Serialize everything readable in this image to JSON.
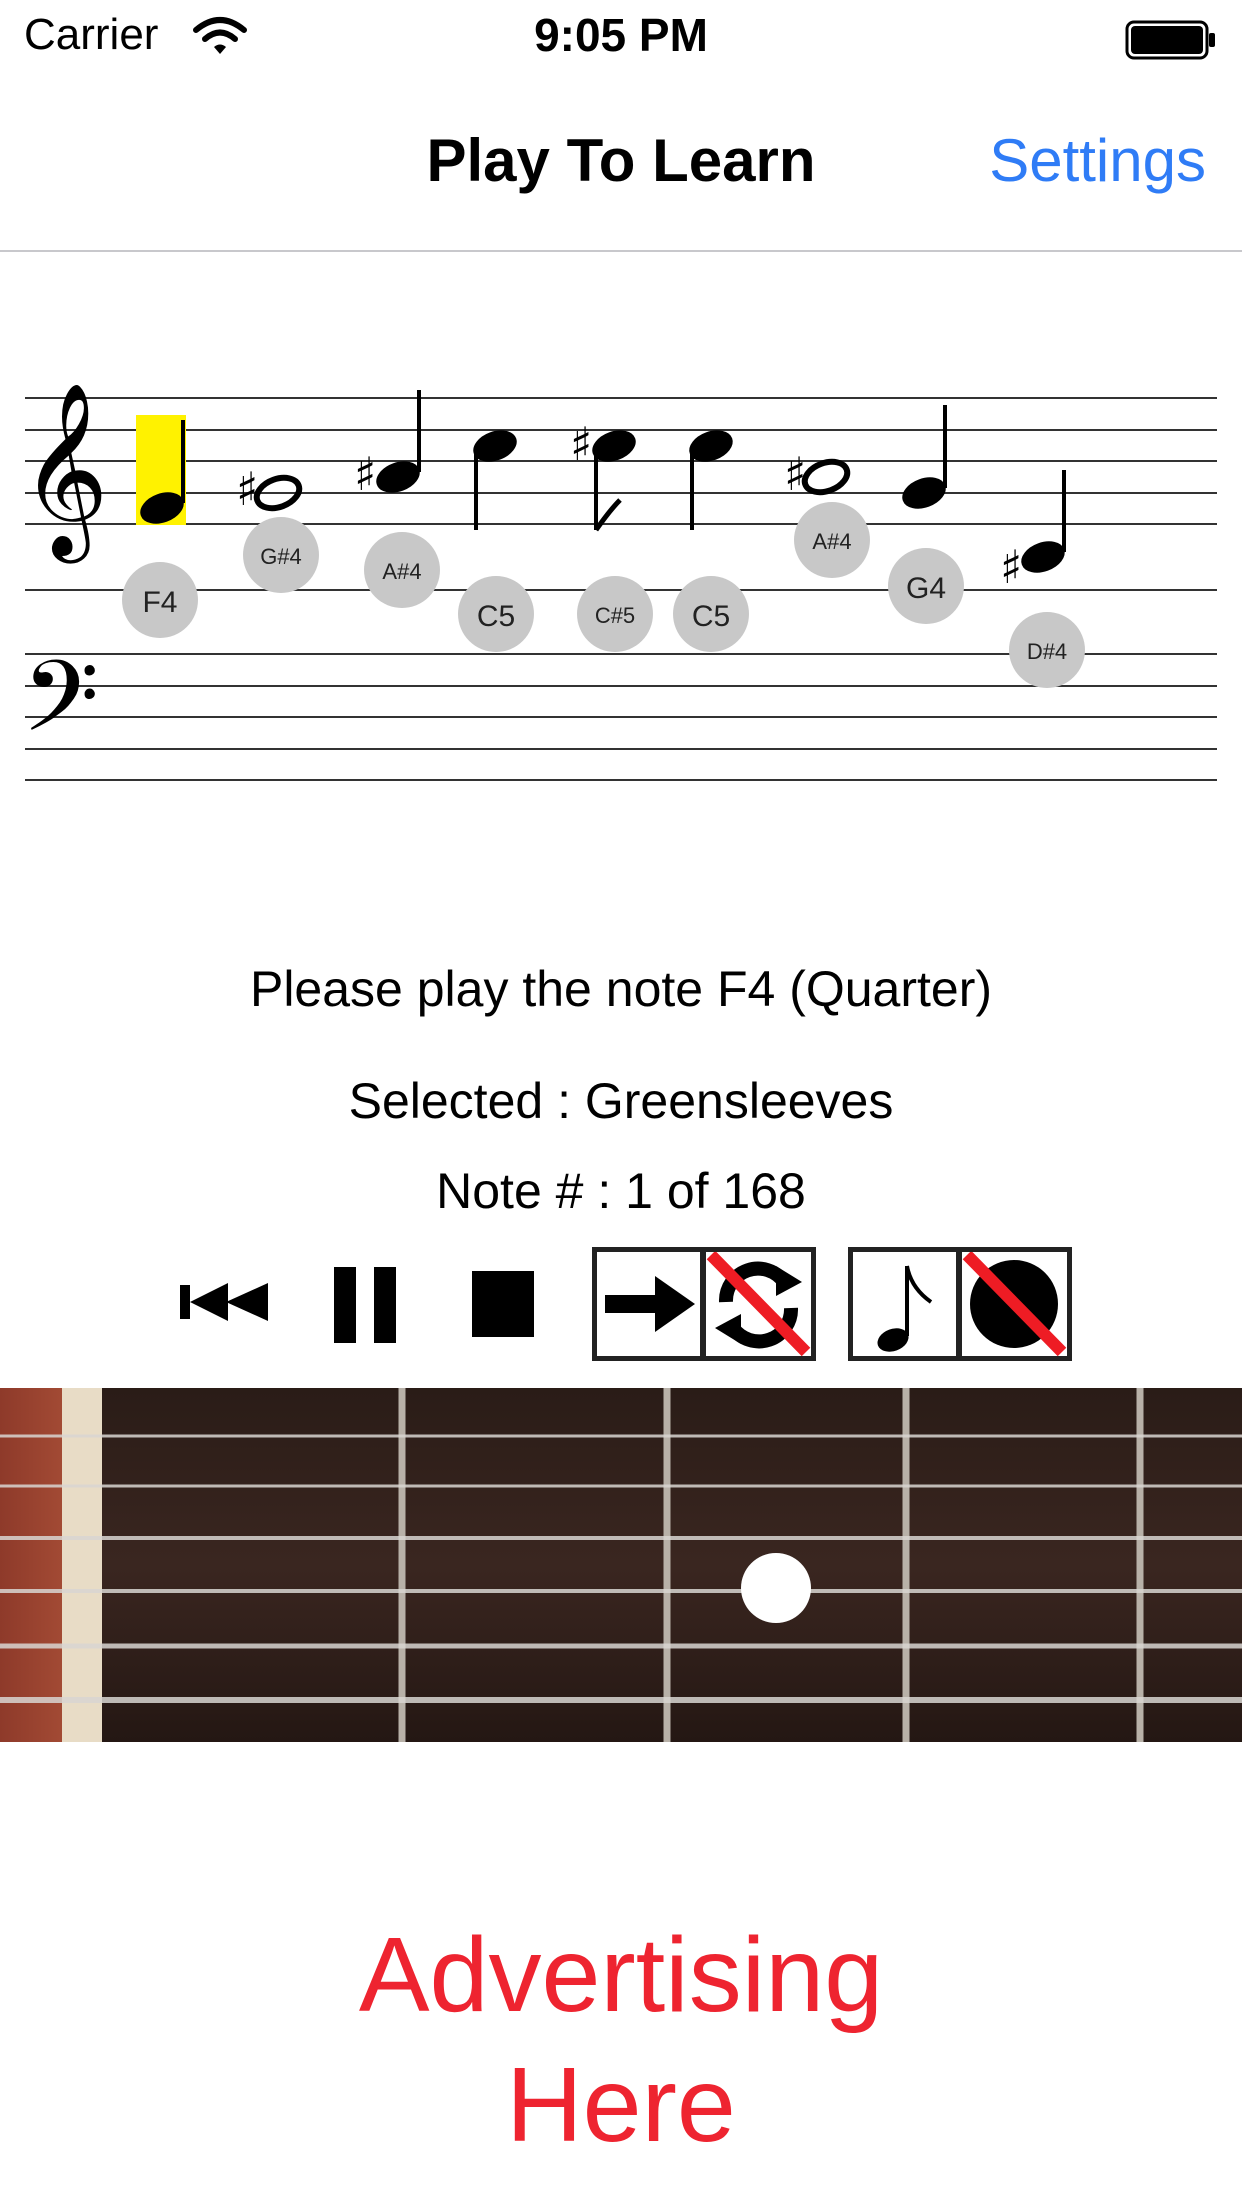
{
  "status_bar": {
    "carrier": "Carrier",
    "time": "9:05 PM"
  },
  "nav": {
    "title": "Play To Learn",
    "settings_label": "Settings"
  },
  "staff": {
    "highlight_color": "#fff200",
    "note_labels": [
      "F4",
      "G#4",
      "A#4",
      "C5",
      "C#5",
      "C5",
      "A#4",
      "G4",
      "D#4"
    ]
  },
  "messages": {
    "prompt": "Please play the note F4 (Quarter)",
    "selected": "Selected : Greensleeves",
    "note_count": "Note # : 1 of 168"
  },
  "controls": {
    "icons": [
      "rewind-icon",
      "pause-icon",
      "stop-icon",
      "step-mode-icon",
      "loop-off-icon",
      "note-sound-icon",
      "record-off-icon"
    ]
  },
  "advertising": {
    "line1": "Advertising",
    "line2": "Here",
    "color": "#ee2430"
  },
  "colors": {
    "link": "#2f7cf6",
    "label_circle": "#c8c8c8"
  }
}
